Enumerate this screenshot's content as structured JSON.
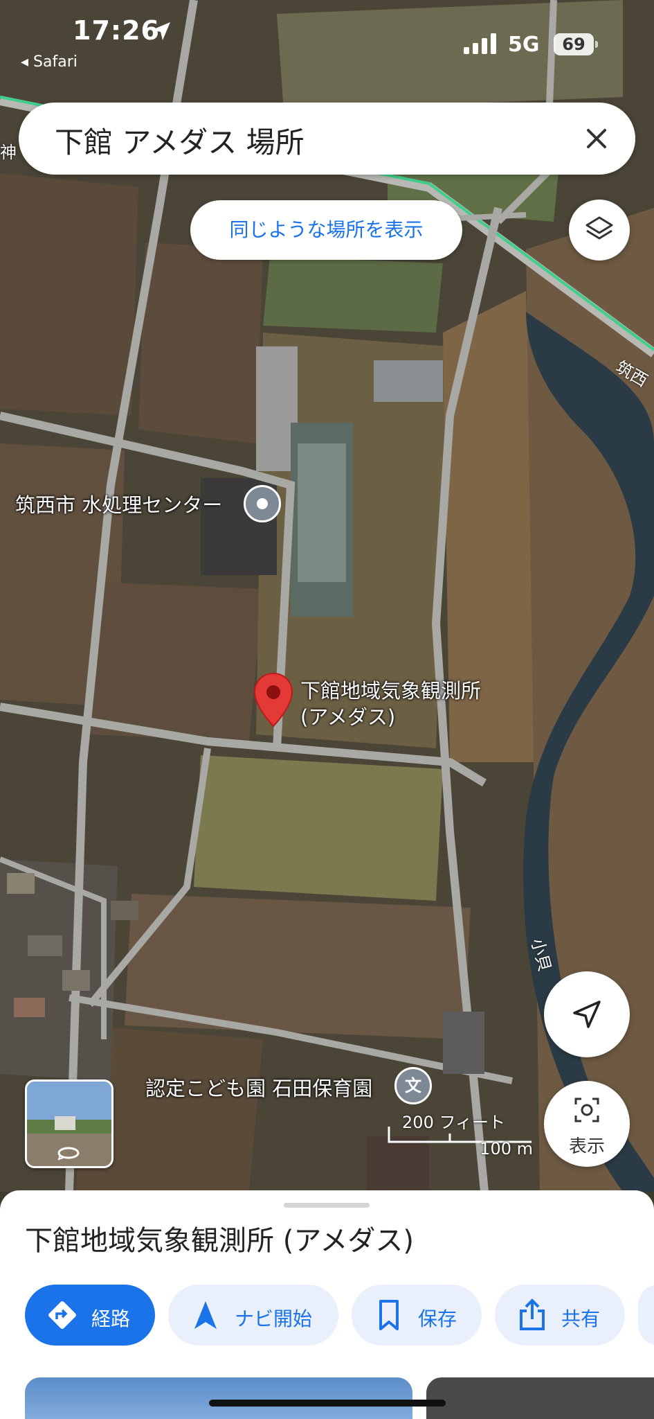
{
  "status_bar": {
    "time": "17:26",
    "back_app": "◂ Safari",
    "network": "5G",
    "battery": "69"
  },
  "search": {
    "query": "下館 アメダス 場所"
  },
  "similar_chip": "同じような場所を表示",
  "map_labels": {
    "water_center": "筑西市 水処理センター",
    "station_line1": "下館地域気象観測所",
    "station_line2": "(アメダス)",
    "nursery": "認定こども園 石田保育園",
    "road_top_left": "神",
    "road_right": "筑西",
    "river": "小貝"
  },
  "scale": {
    "feet": "200 フィート",
    "meters": "100 m"
  },
  "lens_button_label": "表示",
  "sheet": {
    "title": "下館地域気象観測所 (アメダス)",
    "actions": [
      {
        "label": "経路",
        "icon": "directions-icon"
      },
      {
        "label": "ナビ開始",
        "icon": "navigation-arrow-icon"
      },
      {
        "label": "保存",
        "icon": "bookmark-icon"
      },
      {
        "label": "共有",
        "icon": "share-icon"
      }
    ]
  },
  "colors": {
    "accent": "#1a73e8",
    "pin": "#e53935",
    "action_bg": "#e9effb"
  }
}
